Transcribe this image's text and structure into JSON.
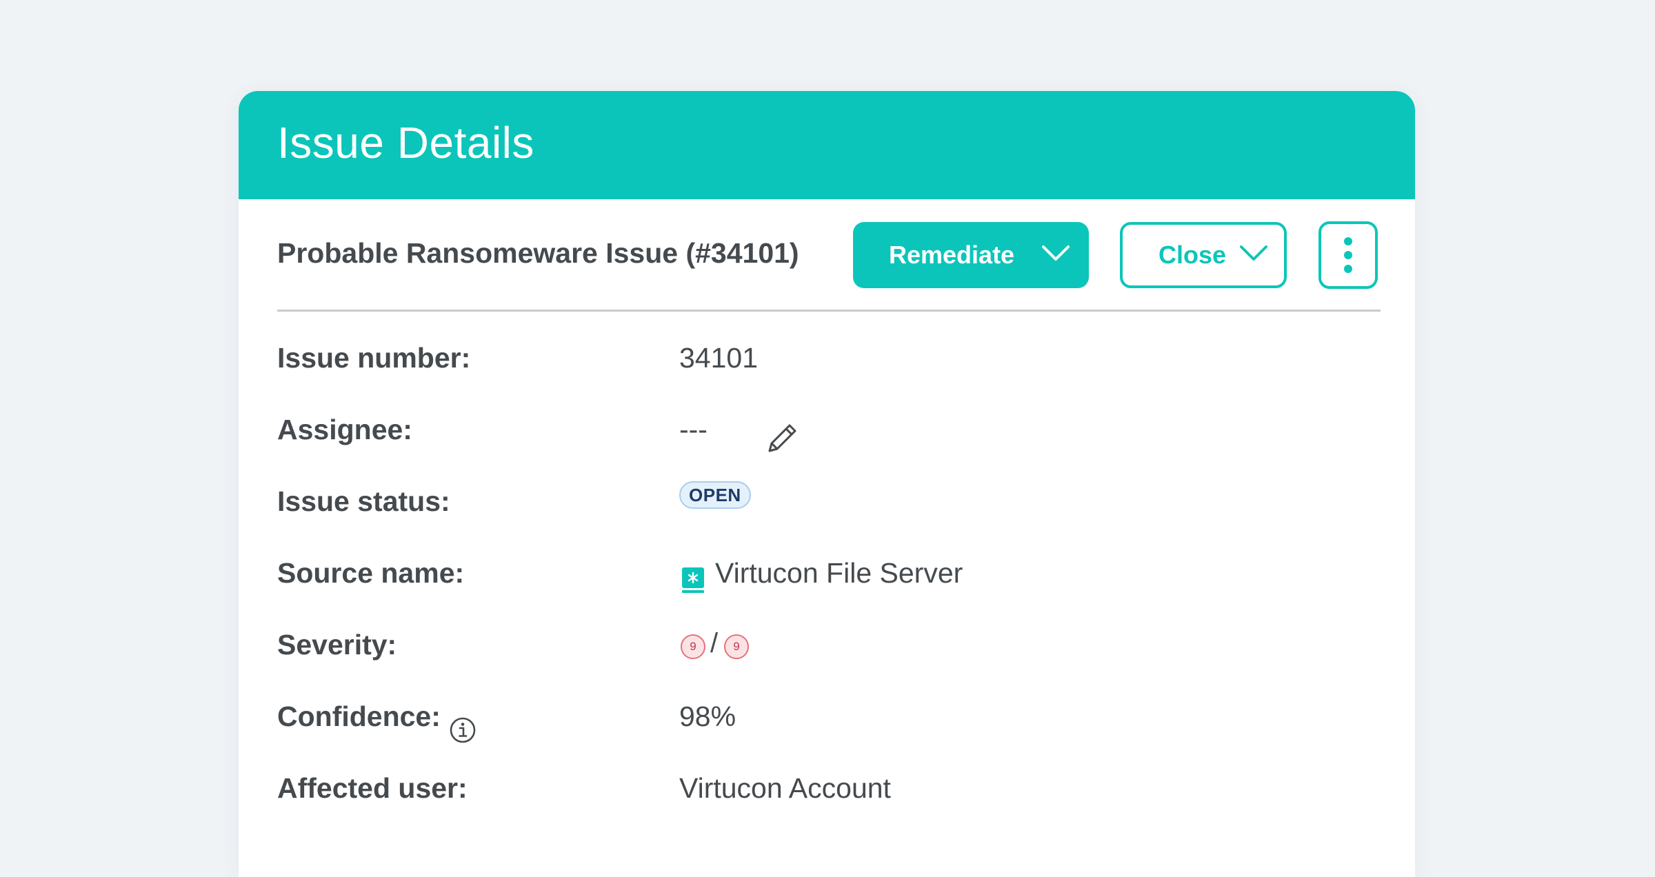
{
  "header": {
    "title": "Issue Details"
  },
  "toolbar": {
    "issue_heading": "Probable Ransomeware Issue (#34101)",
    "remediate_label": "Remediate",
    "close_label": "Close",
    "more_icon": "vertical-ellipsis-icon"
  },
  "details": {
    "issue_number": {
      "label": "Issue number:",
      "value": "34101"
    },
    "assignee": {
      "label": "Assignee:",
      "value": "---",
      "edit_icon": "pencil-icon"
    },
    "issue_status": {
      "label": "Issue status:",
      "value": "OPEN"
    },
    "source_name": {
      "label": "Source name:",
      "value": "Virtucon File Server",
      "icon": "file-server-icon"
    },
    "severity": {
      "label": "Severity:",
      "value": "9",
      "max": "9",
      "separator": "/"
    },
    "confidence": {
      "label": "Confidence:",
      "value": "98%",
      "info_icon": "info-icon"
    },
    "affected_user": {
      "label": "Affected user:",
      "value": "Virtucon Account"
    }
  },
  "colors": {
    "accent": "#0cc5ba",
    "text": "#454a4e",
    "background": "#eff3f6",
    "status_open_bg": "#e4f1fb",
    "status_open_text": "#1f3a67",
    "severity": "#e7707a"
  }
}
